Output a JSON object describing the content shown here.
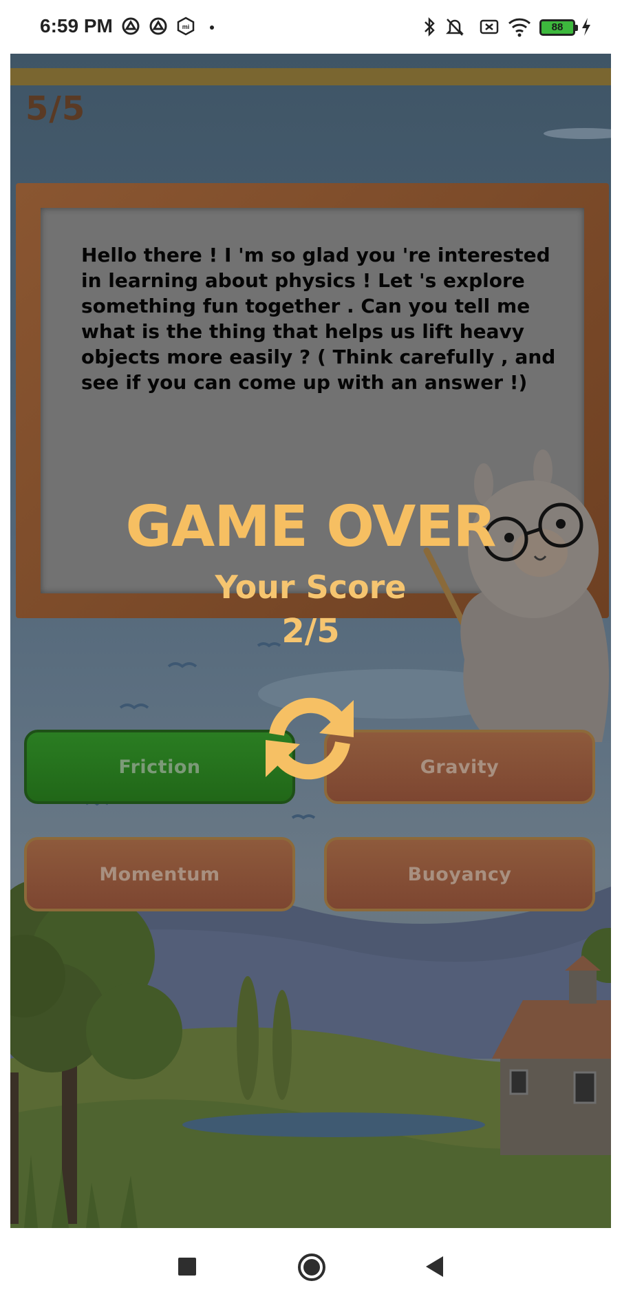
{
  "status_bar": {
    "time": "6:59 PM",
    "battery_level": "88",
    "left_icons": [
      "vpn-icon",
      "vpn-icon",
      "mi-icon",
      "dot-icon"
    ],
    "right_icons": [
      "bluetooth-icon",
      "mute-icon",
      "sim-icon",
      "wifi-icon",
      "battery-icon",
      "charging-icon"
    ]
  },
  "game": {
    "progress": "5/5",
    "question": "Hello there ! I 'm so glad you 're interested in learning about physics ! Let 's explore something fun together . Can you tell me what is the thing that helps us lift heavy objects more easily ? ( Think carefully , and see if you can come up with an answer !)",
    "answers": [
      {
        "label": "Friction",
        "state": "correct"
      },
      {
        "label": "Gravity",
        "state": "wrong"
      },
      {
        "label": "Momentum",
        "state": "wrong"
      },
      {
        "label": "Buoyancy",
        "state": "wrong"
      }
    ],
    "game_over": {
      "title": "GAME OVER",
      "score_label": "Your Score",
      "score": "2/5"
    }
  },
  "colors": {
    "accent": "#f6bf62",
    "correct": "#2a7d22",
    "wrong": "#8e5a3c",
    "board": "#7a4a29",
    "text_dark": "#5a3a24"
  },
  "nav_bar": {
    "buttons": [
      "recents-button",
      "home-button",
      "back-button"
    ]
  }
}
